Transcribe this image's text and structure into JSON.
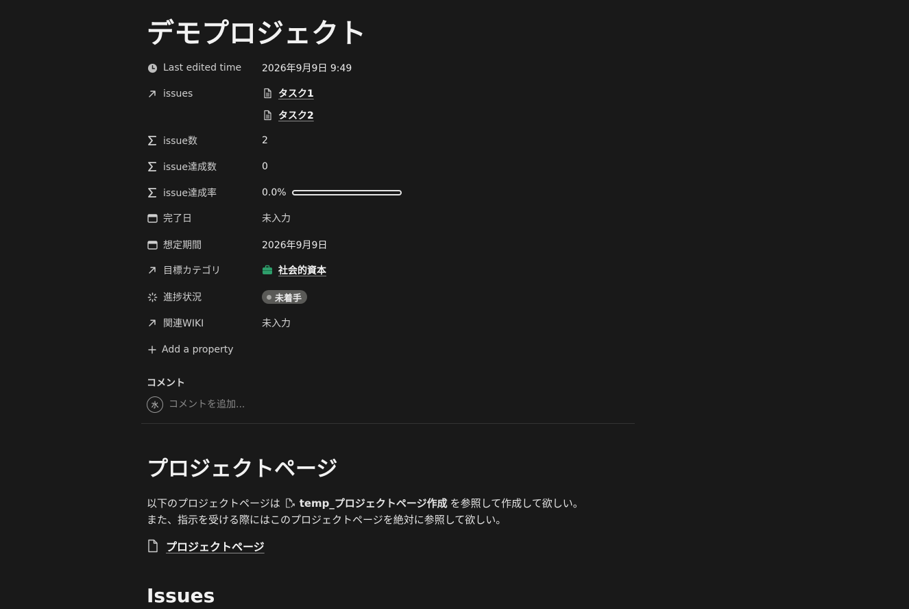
{
  "page": {
    "title": "デモプロジェクト"
  },
  "properties": {
    "last_edited": {
      "label": "Last edited time",
      "value": "2026年9月9日 9:49",
      "icon": "clock-icon"
    },
    "issues": {
      "label": "issues",
      "icon": "relation-arrow-icon",
      "items": [
        "タスク1",
        "タスク2"
      ]
    },
    "issue_count": {
      "label": "issue数",
      "value": "2",
      "icon": "sigma-icon"
    },
    "issue_done_count": {
      "label": "issue達成数",
      "value": "0",
      "icon": "sigma-icon"
    },
    "issue_rate": {
      "label": "issue達成率",
      "value": "0.0%",
      "progress": 0.0,
      "icon": "sigma-icon"
    },
    "completion_date": {
      "label": "完了日",
      "value": "未入力",
      "icon": "calendar-icon"
    },
    "expected_period": {
      "label": "想定期間",
      "value": "2026年9月9日",
      "icon": "calendar-icon"
    },
    "goal_category": {
      "label": "目標カテゴリ",
      "value": "社会的資本",
      "icon": "relation-arrow-icon",
      "value_icon": "briefcase-icon",
      "value_icon_color": "#2e9e6b"
    },
    "progress_status": {
      "label": "進捗状況",
      "value": "未着手",
      "icon": "status-spinner-icon",
      "pill_color": "#5a5a57"
    },
    "related_wiki": {
      "label": "関連WIKI",
      "value": "未入力",
      "icon": "relation-arrow-icon"
    },
    "add_property": "Add a property"
  },
  "comments": {
    "heading": "コメント",
    "avatar_initial": "水",
    "placeholder": "コメントを追加..."
  },
  "section_project": {
    "heading": "プロジェクトページ",
    "line1_before": "以下のプロジェクトページは",
    "line1_mention": "temp_プロジェクトページ作成",
    "line1_after": "を参照して作成して欲しい。",
    "line2": "また、指示を受ける際にはこのプロジェクトページを絶対に参照して欲しい。",
    "page_link": "プロジェクトページ"
  },
  "section_issues": {
    "heading": "Issues"
  },
  "colors": {
    "background": "#191919",
    "text": "#ececec",
    "status_gray": "#5a5a57",
    "category_green": "#2e9e6b"
  }
}
